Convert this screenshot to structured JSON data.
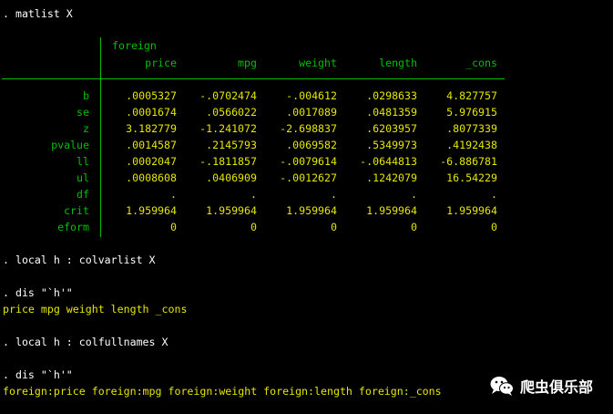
{
  "console": {
    "cmd1": ". matlist X",
    "cmd2": ". local h : colvarlist X",
    "cmd3": ". dis \"`h'\"",
    "out3": "price mpg weight length _cons",
    "cmd4": ". local h : colfullnames X",
    "cmd5": ". dis \"`h'\"",
    "out5": "foreign:price foreign:mpg foreign:weight foreign:length foreign:_cons"
  },
  "matrix": {
    "equation": "foreign",
    "columns": [
      "price",
      "mpg",
      "weight",
      "length",
      "_cons"
    ],
    "rows": [
      {
        "label": "b",
        "values": [
          ".0005327",
          "-.0702474",
          "-.004612",
          ".0298633",
          "4.827757"
        ]
      },
      {
        "label": "se",
        "values": [
          ".0001674",
          ".0566022",
          ".0017089",
          ".0481359",
          "5.976915"
        ]
      },
      {
        "label": "z",
        "values": [
          "3.182779",
          "-1.241072",
          "-2.698837",
          ".6203957",
          ".8077339"
        ]
      },
      {
        "label": "pvalue",
        "values": [
          ".0014587",
          ".2145793",
          ".0069582",
          ".5349973",
          ".4192438"
        ]
      },
      {
        "label": "ll",
        "values": [
          ".0002047",
          "-.1811857",
          "-.0079614",
          "-.0644813",
          "-6.886781"
        ]
      },
      {
        "label": "ul",
        "values": [
          ".0008608",
          ".0406909",
          "-.0012627",
          ".1242079",
          "16.54229"
        ]
      },
      {
        "label": "df",
        "values": [
          ".",
          ".",
          ".",
          ".",
          "."
        ]
      },
      {
        "label": "crit",
        "values": [
          "1.959964",
          "1.959964",
          "1.959964",
          "1.959964",
          "1.959964"
        ]
      },
      {
        "label": "eform",
        "values": [
          "0",
          "0",
          "0",
          "0",
          "0"
        ]
      }
    ]
  },
  "watermark": {
    "text": "爬虫俱乐部",
    "icon": "wechat-bubble-icon"
  },
  "colors": {
    "background": "#000000",
    "command": "#ffffff",
    "result": "#e5e600",
    "label": "#00c000"
  }
}
